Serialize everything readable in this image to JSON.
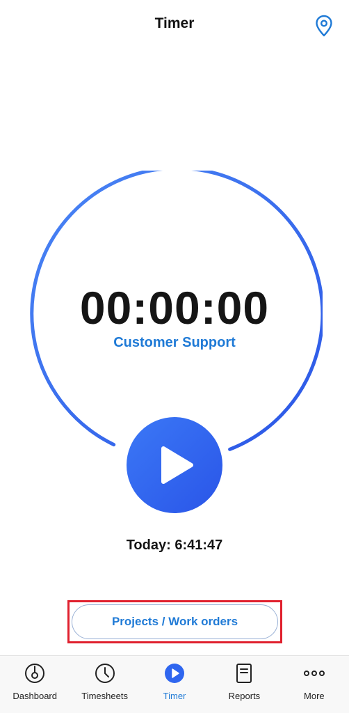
{
  "header": {
    "title": "Timer",
    "location_icon": "map-pin-icon"
  },
  "timer": {
    "elapsed": "00:00:00",
    "project": "Customer Support",
    "play_icon": "play-icon",
    "ring_color": "#3d6ff0"
  },
  "summary": {
    "today": "Today: 6:41:47"
  },
  "actions": {
    "projects_label": "Projects / Work orders"
  },
  "tabbar": {
    "active_color": "#1f7ad6",
    "items": [
      {
        "label": "Dashboard",
        "icon": "dashboard-icon"
      },
      {
        "label": "Timesheets",
        "icon": "clock-icon"
      },
      {
        "label": "Timer",
        "icon": "play-circle-icon"
      },
      {
        "label": "Reports",
        "icon": "document-icon"
      },
      {
        "label": "More",
        "icon": "more-dots-icon"
      }
    ]
  }
}
